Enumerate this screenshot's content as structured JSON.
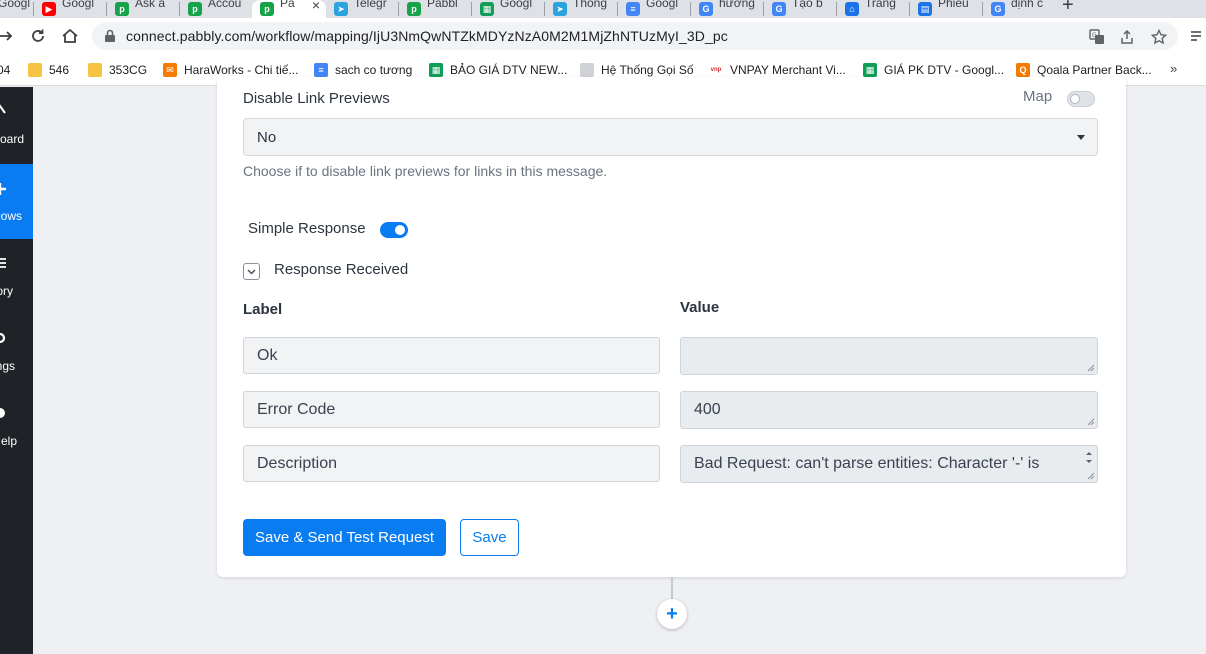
{
  "browser": {
    "tabs": [
      {
        "label": "Googl",
        "color": "#e8710a"
      },
      {
        "label": "Googl",
        "color": "#ff0000"
      },
      {
        "label": "Ask a",
        "color": "#16a34a"
      },
      {
        "label": "Accou",
        "color": "#16a34a"
      },
      {
        "label": "Pa",
        "color": "#16a34a"
      },
      {
        "label": "Telegr",
        "color": "#2aa3df"
      },
      {
        "label": "Pabbl",
        "color": "#16a34a"
      },
      {
        "label": "Googl",
        "color": "#0f9d58"
      },
      {
        "label": "Thông",
        "color": "#2aa3df"
      },
      {
        "label": "Googl",
        "color": "#4285f4"
      },
      {
        "label": "hướng",
        "color": "#4285f4"
      },
      {
        "label": "Tạo b",
        "color": "#4285f4"
      },
      {
        "label": "Trang",
        "color": "#1a73e8"
      },
      {
        "label": "Phiếu",
        "color": "#1a73e8"
      },
      {
        "label": "định c",
        "color": "#4285f4"
      }
    ],
    "close_glyph": "×",
    "new_tab_glyph": "+",
    "url": "connect.pabbly.com/workflow/mapping/IjU3NmQwNTZkMDYzNzA0M2M1MjZhNTUzMyI_3D_pc",
    "bookmarks": [
      {
        "label": "04",
        "color": ""
      },
      {
        "label": "546",
        "color": "#f6c343"
      },
      {
        "label": "353CG",
        "color": "#f6c343"
      },
      {
        "label": "HaraWorks - Chi tiế...",
        "color": "#f57c00"
      },
      {
        "label": "sach co tương",
        "color": "#4285f4"
      },
      {
        "label": "BẢO GIÁ DTV NEW...",
        "color": "#0f9d58"
      },
      {
        "label": "Hệ Thống Gọi Số",
        "color": "#9aa0a6"
      },
      {
        "label": "VNPAY Merchant Vi...",
        "color": "#d32f2f"
      },
      {
        "label": "GIÁ PK DTV - Googl...",
        "color": "#0f9d58"
      },
      {
        "label": "Qoala Partner Back...",
        "color": "#f57c00"
      }
    ],
    "bookmarks_more": "»"
  },
  "sidebar": {
    "items": [
      {
        "label": "board"
      },
      {
        "label": "lows"
      },
      {
        "label": "ory"
      },
      {
        "label": "ngs"
      },
      {
        "label": "elp"
      }
    ]
  },
  "form": {
    "disable_link_previews": {
      "label": "Disable Link Previews",
      "map_label": "Map",
      "value": "No",
      "help": "Choose if to disable link previews for links in this message."
    },
    "simple_response_label": "Simple Response",
    "response_received_label": "Response Received",
    "columns": {
      "label": "Label",
      "value": "Value"
    },
    "rows": [
      {
        "label": "Ok",
        "value": ""
      },
      {
        "label": "Error Code",
        "value": "400"
      },
      {
        "label": "Description",
        "value": "Bad Request: can't parse entities: Character '-' is"
      }
    ],
    "buttons": {
      "save_and_test": "Save & Send Test Request",
      "save": "Save"
    },
    "add_step_glyph": "+"
  }
}
